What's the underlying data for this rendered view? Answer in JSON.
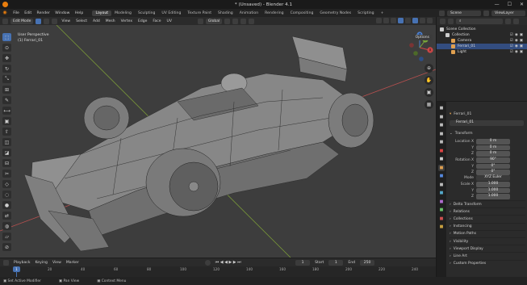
{
  "window": {
    "title": "* (Unsaved) - Blender 4.1",
    "controls": [
      "—",
      "☐",
      "✕"
    ]
  },
  "menubar": {
    "menus": [
      "File",
      "Edit",
      "Render",
      "Window",
      "Help"
    ],
    "workspaces": [
      "Layout",
      "Modeling",
      "Sculpting",
      "UV Editing",
      "Texture Paint",
      "Shading",
      "Animation",
      "Rendering",
      "Compositing",
      "Geometry Nodes",
      "Scripting"
    ],
    "active_workspace": "Layout",
    "scene": "Scene",
    "view_layer": "ViewLayer"
  },
  "viewport_header": {
    "mode": "Edit Mode",
    "menus": [
      "View",
      "Select",
      "Add",
      "Mesh",
      "Vertex",
      "Edge",
      "Face",
      "UV"
    ],
    "orientation": "Global",
    "options": "Options"
  },
  "viewport": {
    "perspective_label": "User Perspective",
    "object_label": "(1) Ferrari_01",
    "background": "#3d3d3d",
    "grid_x_color": "#b8504f",
    "grid_y_color": "#7a9a38",
    "gizmo": {
      "x": "X",
      "y": "Y",
      "z": "Z"
    }
  },
  "toolbar": {
    "tools": [
      "select-box",
      "cursor",
      "move",
      "rotate",
      "scale",
      "transform",
      "annotate",
      "measure",
      "add-cube",
      "extrude",
      "inset",
      "bevel",
      "loop-cut",
      "knife",
      "poly-build",
      "spin",
      "smooth",
      "edge-slide",
      "shrink",
      "shear",
      "rip"
    ]
  },
  "timeline": {
    "menus": [
      "Playback",
      "Keying",
      "View",
      "Marker"
    ],
    "current_frame": "1",
    "start_label": "Start",
    "start": "1",
    "end_label": "End",
    "end": "250",
    "ticks": [
      "0",
      "20",
      "40",
      "60",
      "80",
      "100",
      "120",
      "140",
      "160",
      "180",
      "200",
      "220",
      "240"
    ]
  },
  "statusbar": {
    "items": [
      "Set Active Modifier",
      "Pan View",
      "Context Menu"
    ]
  },
  "outliner": {
    "search_placeholder": "",
    "rows": [
      {
        "label": "Scene Collection",
        "icon_color": "#cccccc",
        "selected": false,
        "indent": 0
      },
      {
        "label": "Collection",
        "icon_color": "#cccccc",
        "selected": false,
        "indent": 1
      },
      {
        "label": "Camera",
        "icon_color": "#e0a050",
        "selected": false,
        "indent": 2
      },
      {
        "label": "Ferrari_01",
        "icon_color": "#e0a050",
        "selected": true,
        "indent": 2
      },
      {
        "label": "Light",
        "icon_color": "#e0a050",
        "selected": false,
        "indent": 2
      }
    ]
  },
  "properties": {
    "object_name": "Ferrari_01",
    "object_field": "Ferrari_01",
    "transform_header": "Transform",
    "location": {
      "label": "Location X",
      "x": "0 m",
      "y": "0 m",
      "z": "0 m"
    },
    "rotation": {
      "label": "Rotation X",
      "x": "90°",
      "y": "0°",
      "z": "0°"
    },
    "mode_label": "Mode",
    "mode_value": "XYZ Euler",
    "scale": {
      "label": "Scale X",
      "x": "1.000",
      "y": "1.000",
      "z": "1.000"
    },
    "axis_y": "Y",
    "axis_z": "Z",
    "panels": [
      "Delta Transform",
      "Relations",
      "Collections",
      "Instancing",
      "Motion Paths",
      "Visibility",
      "Viewport Display",
      "Line Art",
      "Custom Properties"
    ]
  }
}
